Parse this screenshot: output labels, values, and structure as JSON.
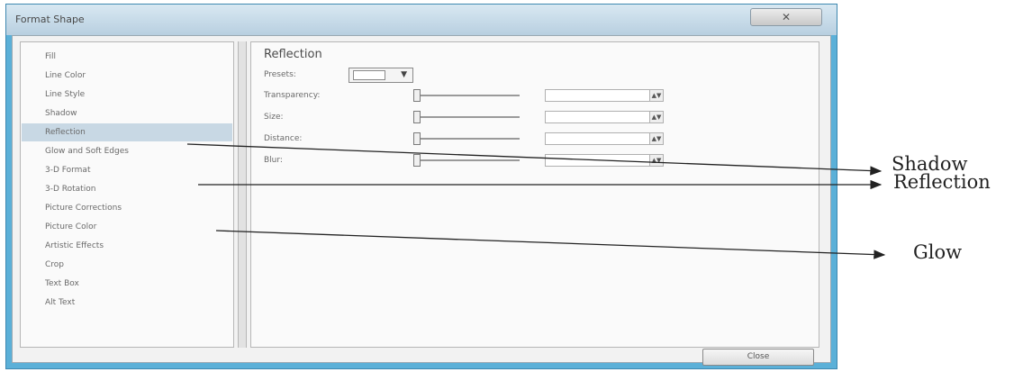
{
  "dialog": {
    "title": "Format Shape",
    "close_icon": "x-icon"
  },
  "nav": {
    "items": [
      {
        "label": "Fill",
        "selected": false
      },
      {
        "label": "Line Color",
        "selected": false
      },
      {
        "label": "Line Style",
        "selected": false
      },
      {
        "label": "Shadow",
        "selected": false
      },
      {
        "label": "Reflection",
        "selected": true
      },
      {
        "label": "Glow and Soft Edges",
        "selected": false
      },
      {
        "label": "3-D Format",
        "selected": false
      },
      {
        "label": "3-D Rotation",
        "selected": false
      },
      {
        "label": "Picture Corrections",
        "selected": false
      },
      {
        "label": "Picture Color",
        "selected": false
      },
      {
        "label": "Artistic Effects",
        "selected": false
      },
      {
        "label": "Crop",
        "selected": false
      },
      {
        "label": "Text Box",
        "selected": false
      },
      {
        "label": "Alt Text",
        "selected": false
      }
    ]
  },
  "panel": {
    "title": "Reflection",
    "presets_label": "Presets:",
    "options": [
      {
        "label": "Transparency:",
        "value": ""
      },
      {
        "label": "Size:",
        "value": ""
      },
      {
        "label": "Distance:",
        "value": ""
      },
      {
        "label": "Blur:",
        "value": ""
      }
    ]
  },
  "footer": {
    "close_label": "Close"
  },
  "annotations": {
    "shadow": "Shadow",
    "reflection": "Reflection",
    "glow": "Glow"
  },
  "colors": {
    "window_frame": "#5bb0d8",
    "selected_item": "#c8d8e4"
  }
}
